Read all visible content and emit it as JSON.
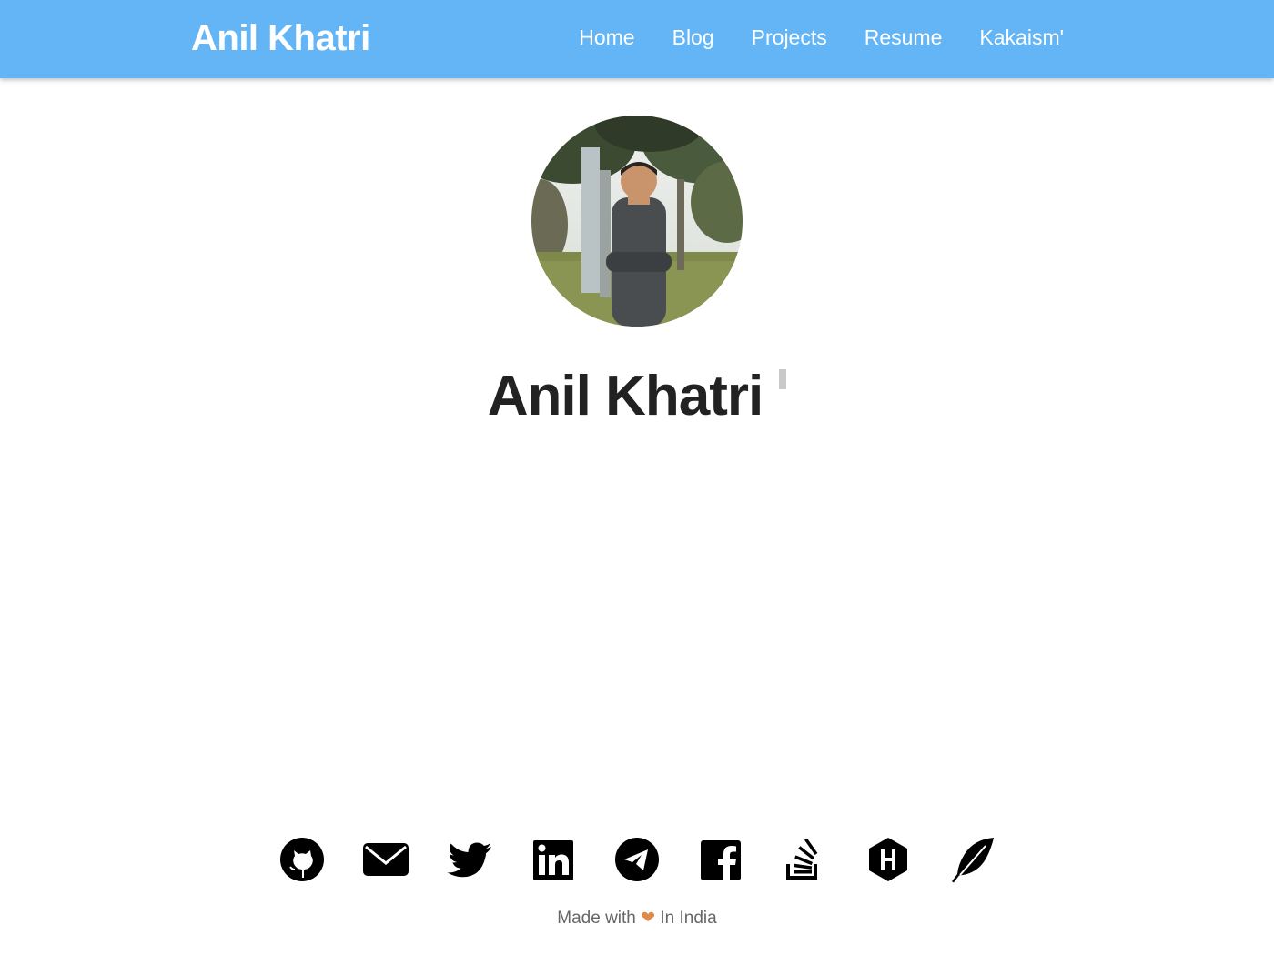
{
  "nav": {
    "brand": "Anil Khatri",
    "links": [
      "Home",
      "Blog",
      "Projects",
      "Resume",
      "Kakaism'"
    ]
  },
  "hero": {
    "name": "Anil Khatri"
  },
  "socials": [
    {
      "name": "github-icon"
    },
    {
      "name": "email-icon"
    },
    {
      "name": "twitter-icon"
    },
    {
      "name": "linkedin-icon"
    },
    {
      "name": "telegram-icon"
    },
    {
      "name": "facebook-icon"
    },
    {
      "name": "stackoverflow-icon"
    },
    {
      "name": "hackerrank-icon"
    },
    {
      "name": "feather-icon"
    }
  ],
  "footer": {
    "made_with": "Made with",
    "heart": "❤",
    "location": "In India"
  },
  "colors": {
    "navbar": "#64b5f6",
    "text": "#222222",
    "footer_text": "#666666"
  }
}
